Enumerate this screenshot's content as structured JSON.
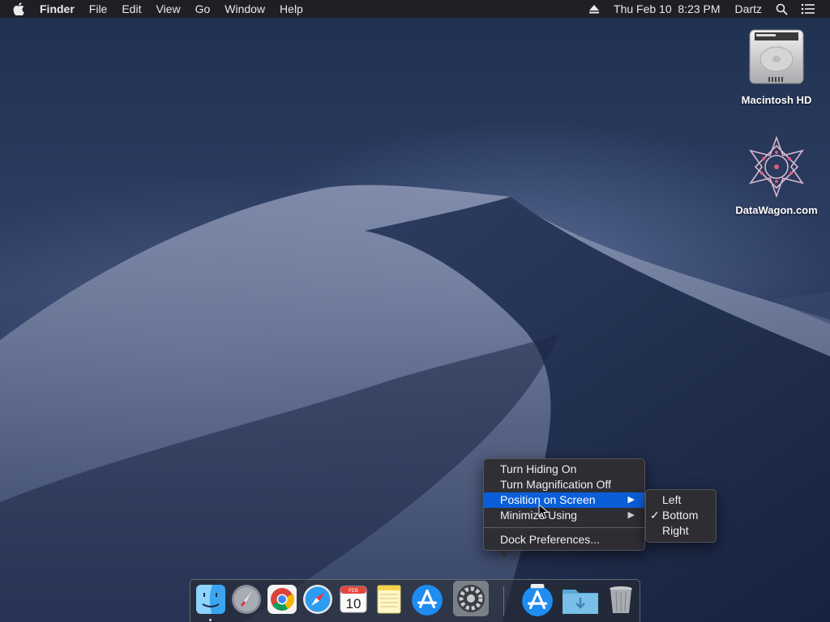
{
  "menubar": {
    "app_name": "Finder",
    "menus": [
      "File",
      "Edit",
      "View",
      "Go",
      "Window",
      "Help"
    ],
    "datetime": "Thu Feb 10  8:23 PM",
    "user": "Dartz"
  },
  "desktop": {
    "icons": [
      {
        "label": "Macintosh HD"
      },
      {
        "label": "DataWagon.com"
      }
    ]
  },
  "dock_menu": {
    "items": [
      "Turn Hiding On",
      "Turn Magnification Off",
      "Position on Screen",
      "Minimize Using",
      "Dock Preferences..."
    ],
    "highlighted": "Position on Screen"
  },
  "position_submenu": {
    "items": [
      "Left",
      "Bottom",
      "Right"
    ],
    "checked": "Bottom"
  },
  "dock": {
    "apps": [
      "finder-icon",
      "launchpad-icon",
      "chrome-icon",
      "safari-icon",
      "calendar-icon",
      "notes-icon",
      "app-store-icon",
      "system-preferences-icon",
      "app-store-download-icon",
      "downloads-folder-icon",
      "trash-icon"
    ],
    "calendar": {
      "month": "FEB",
      "day": "10"
    }
  },
  "colors": {
    "menu_highlight": "#0a5fd8",
    "menubar_bg": "#1e1e22"
  }
}
